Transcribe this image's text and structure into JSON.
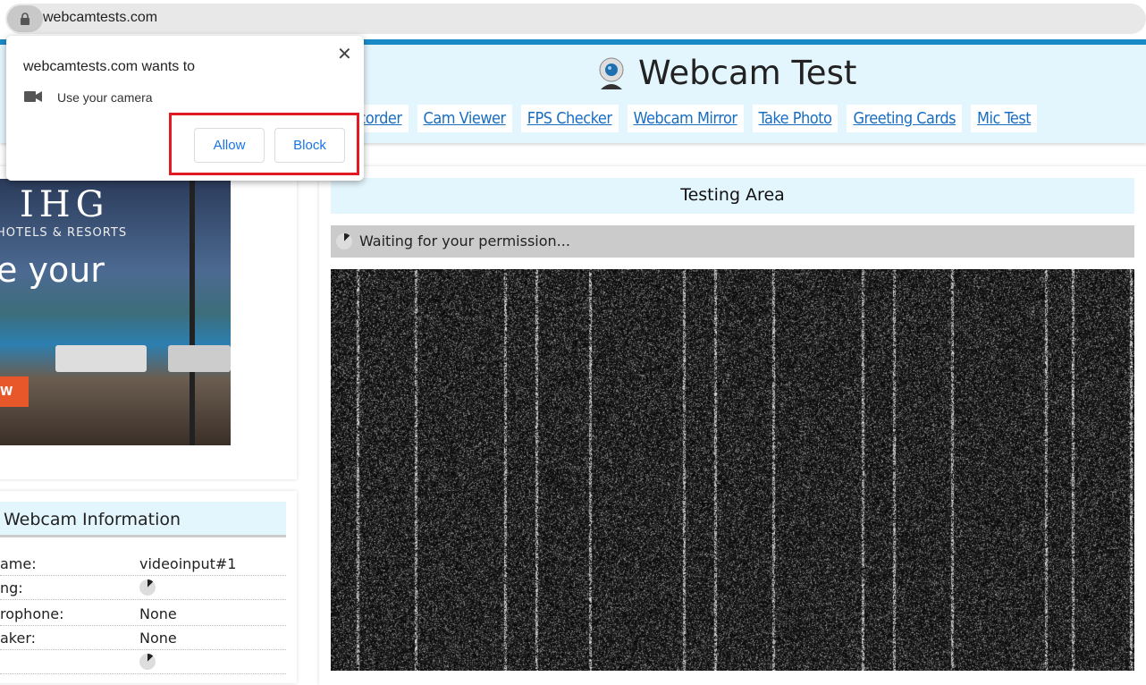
{
  "browser": {
    "url": "webcamtests.com"
  },
  "site": {
    "title": "Webcam Test",
    "nav": [
      "ecorder",
      "Cam Viewer",
      "FPS Checker",
      "Webcam Mirror",
      "Take Photo",
      "Greeting Cards",
      "Mic Test"
    ]
  },
  "ad": {
    "brand": "IHG",
    "subbrand": "HOTELS & RESORTS",
    "headline": "e your",
    "cta": "W"
  },
  "info": {
    "title": "Webcam Information",
    "rows": [
      {
        "k": "ame:",
        "v": "videoinput#1"
      },
      {
        "k": "ng:",
        "v": ""
      },
      {
        "k": "rophone:",
        "v": "None"
      },
      {
        "k": "aker:",
        "v": "None"
      },
      {
        "k": "",
        "v": ""
      }
    ]
  },
  "testing": {
    "title": "Testing Area",
    "status": "Waiting for your permission..."
  },
  "popup": {
    "title": "webcamtests.com wants to",
    "permission": "Use your camera",
    "allow": "Allow",
    "block": "Block",
    "close": "✕"
  },
  "colors": {
    "accent": "#1a8ac6",
    "header_bg": "#e4f6fd",
    "link": "#1a6ec2",
    "highlight": "#e01b24"
  }
}
